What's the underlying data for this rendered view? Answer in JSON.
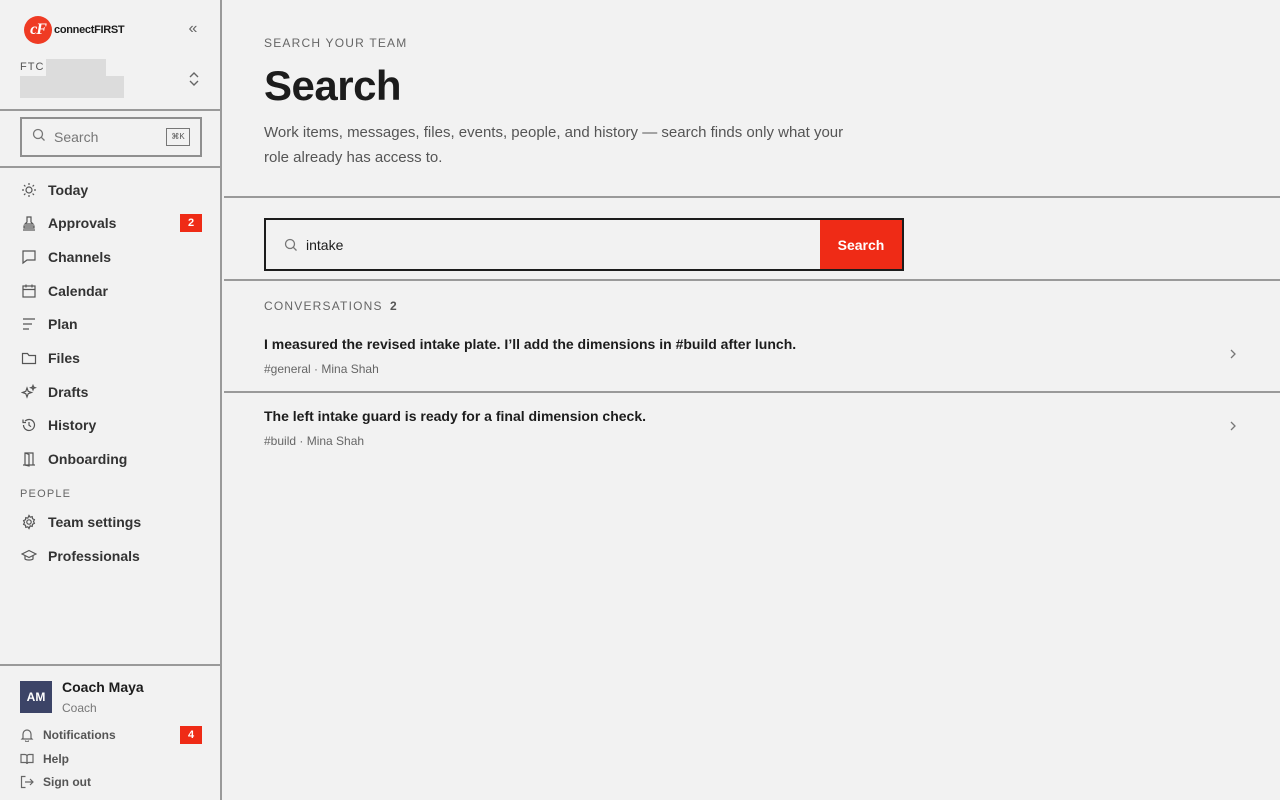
{
  "brand": {
    "mark": "cF",
    "name": "connectFIRST"
  },
  "team": {
    "label": "FTC"
  },
  "sidebar": {
    "search_placeholder": "Search",
    "search_shortcut": "⌘K",
    "nav": [
      {
        "label": "Today",
        "icon": "sun-icon"
      },
      {
        "label": "Approvals",
        "icon": "stamp-icon",
        "badge": "2"
      },
      {
        "label": "Channels",
        "icon": "chat-bubble-icon"
      },
      {
        "label": "Calendar",
        "icon": "calendar-icon"
      },
      {
        "label": "Plan",
        "icon": "lines-icon"
      },
      {
        "label": "Files",
        "icon": "folder-icon"
      },
      {
        "label": "Drafts",
        "icon": "sparkle-icon"
      },
      {
        "label": "History",
        "icon": "history-icon"
      },
      {
        "label": "Onboarding",
        "icon": "door-icon"
      }
    ],
    "section_people": "PEOPLE",
    "people": [
      {
        "label": "Team settings",
        "icon": "gear-icon"
      },
      {
        "label": "Professionals",
        "icon": "graduation-cap-icon"
      }
    ]
  },
  "user": {
    "initials": "AM",
    "name": "Coach Maya",
    "role": "Coach"
  },
  "footer": {
    "notifications": {
      "label": "Notifications",
      "badge": "4"
    },
    "help": {
      "label": "Help"
    },
    "signout": {
      "label": "Sign out"
    }
  },
  "main": {
    "eyebrow": "SEARCH YOUR TEAM",
    "title": "Search",
    "description": "Work items, messages, files, events, people, and history — search finds only what your role already has access to.",
    "query": "intake",
    "search_button": "Search",
    "results_section": "CONVERSATIONS",
    "results_count": "2",
    "results": [
      {
        "title": "I measured the revised intake plate. I’ll add the dimensions in #build after lunch.",
        "meta": "#general · Mina Shah"
      },
      {
        "title": "The left intake guard is ready for a final dimension check.",
        "meta": "#build · Mina Shah"
      }
    ]
  },
  "colors": {
    "accent": "#ef2b16",
    "avatar": "#3c4467"
  }
}
